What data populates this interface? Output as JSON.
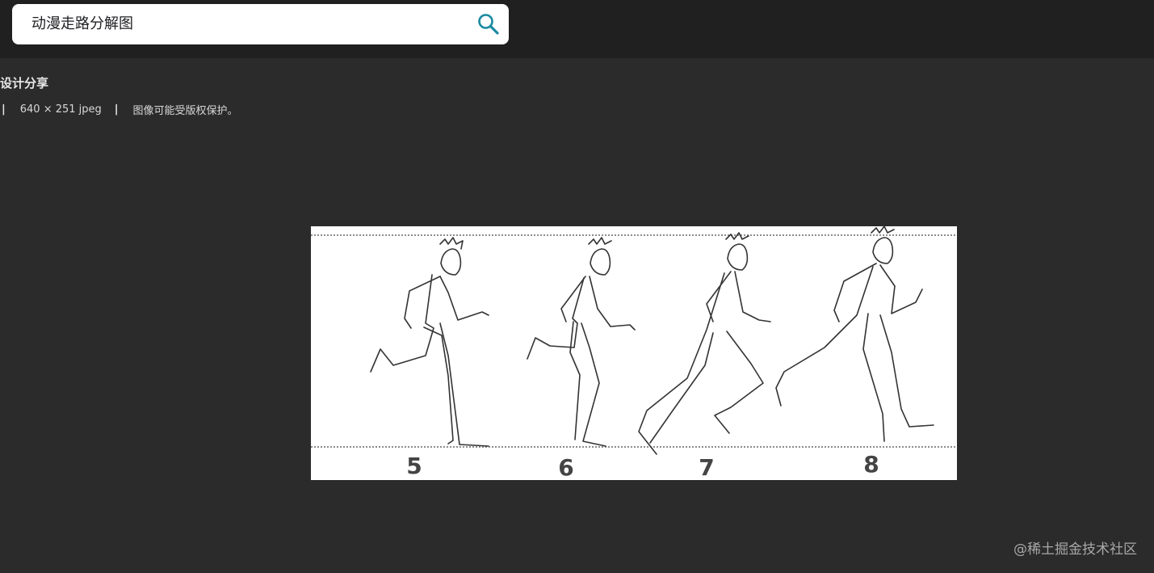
{
  "search": {
    "query": "动漫走路分解图",
    "icon": "search-icon",
    "accent_color": "#1a8aa0"
  },
  "result": {
    "title": "设计分享",
    "separator": "|",
    "dimensions": "640 × 251 jpeg",
    "copyright": "图像可能受版权保护。"
  },
  "preview": {
    "frame_labels": [
      "5",
      "6",
      "7",
      "8"
    ]
  },
  "watermark": {
    "text": "@稀土掘金技术社区"
  }
}
